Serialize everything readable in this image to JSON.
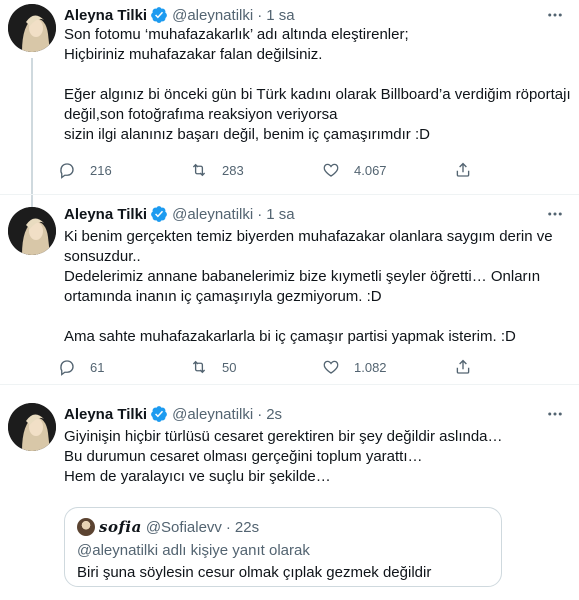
{
  "tweets": [
    {
      "name": "Aleyna Tilki",
      "handle": "@aleynatilki",
      "dot": "·",
      "time": "1 sa",
      "text_lines": [
        "Son fotomu ‘muhafazakarlık’ adı altında eleştirenler;",
        "Hiçbiriniz muhafazakar falan değilsiniz.",
        "",
        "Eğer algınız bi önceki gün bi Türk kadını olarak Billboard’a verdiğim röportajı",
        "değil,son fotoğrafıma reaksiyon veriyorsa",
        "sizin ilgi alanınız başarı değil, benim iç çamaşırımdır :D"
      ],
      "replies": "216",
      "retweets": "283",
      "likes": "4.067"
    },
    {
      "name": "Aleyna Tilki",
      "handle": "@aleynatilki",
      "dot": "·",
      "time": "1 sa",
      "text_lines": [
        "Ki benim gerçekten temiz biyerden muhafazakar olanlara saygım derin ve",
        "sonsuzdur..",
        "Dedelerimiz annane babanelerimiz bize kıymetli şeyler öğretti… Onların",
        "ortamında inanın iç çamaşırıyla gezmiyorum. :D",
        "",
        "Ama sahte muhafazakarlarla bi iç çamaşır partisi yapmak isterim. :D"
      ],
      "replies": "61",
      "retweets": "50",
      "likes": "1.082"
    },
    {
      "name": "Aleyna Tilki",
      "handle": "@aleynatilki",
      "dot": "·",
      "time": "2s",
      "text_lines": [
        "Giyinişin hiçbir türlüsü cesaret gerektiren bir şey değildir aslında…",
        "Bu durumun cesaret olması gerçeğini toplum yarattı…",
        "Hem de yaralayıcı ve suçlu bir şekilde…"
      ],
      "quote": {
        "name": "𝒔𝒐𝒇𝒊𝒂",
        "handle": "@Sofialevv",
        "dot": "·",
        "time": "22s",
        "reply_to": "@aleynatilki adlı kişiye yanıt olarak",
        "text": "Biri şuna söylesin cesur olmak çıplak gezmek değildir"
      }
    }
  ],
  "icons": {
    "verified": "verified-badge-icon",
    "more": "more-options-icon",
    "reply": "reply-icon",
    "retweet": "retweet-icon",
    "like": "like-icon",
    "share": "share-icon"
  },
  "colors": {
    "verified": "#1d9bf0",
    "secondary_text": "#536471",
    "divider": "#eff3f4",
    "thread_line": "#cfd9de"
  }
}
